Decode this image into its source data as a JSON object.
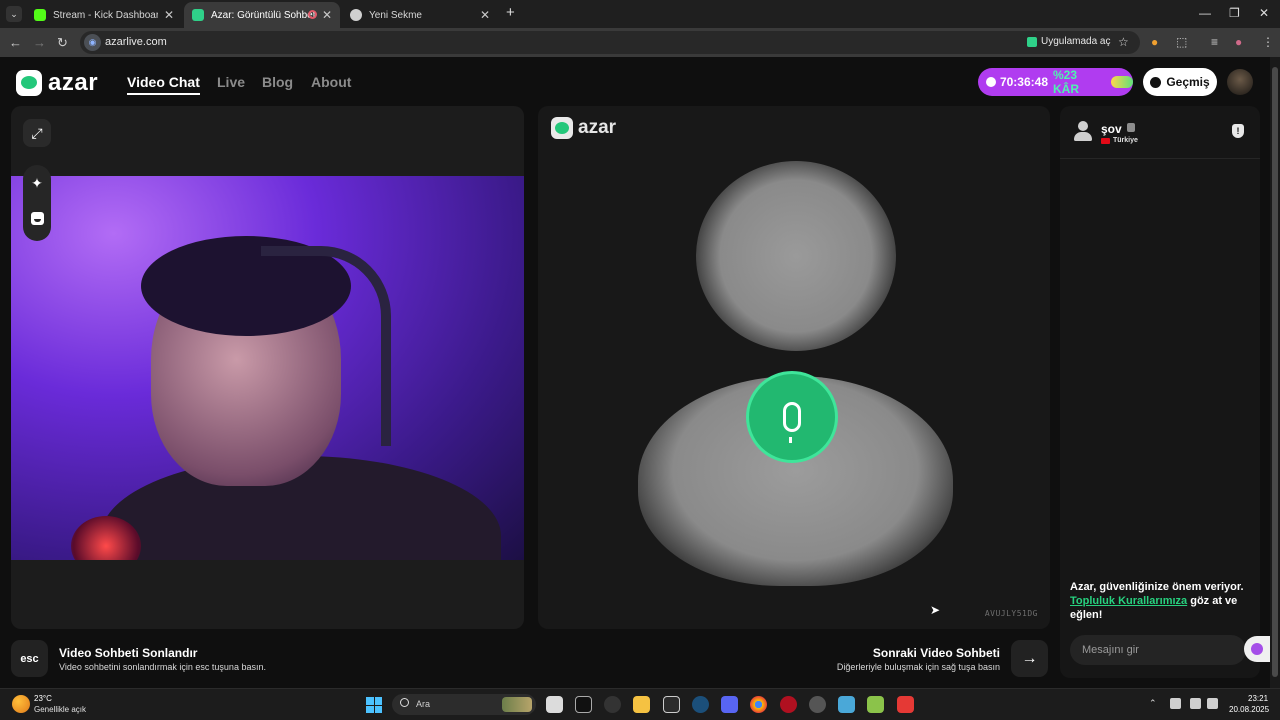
{
  "browser": {
    "tabs": [
      {
        "label": "Stream - Kick Dashboard",
        "icon": "kick-icon",
        "color": "#53fc18"
      },
      {
        "label": "Azar: Görüntülü Sohbet, Arl",
        "icon": "azar-icon",
        "color": "#2fd189"
      },
      {
        "label": "Yeni Sekme",
        "icon": "chrome-icon",
        "color": "#d0d0d0"
      }
    ],
    "new_tab": "+",
    "url": "azarlive.com",
    "open_in_app": "Uygulamada aç"
  },
  "header": {
    "logo_text": "azar",
    "nav": [
      {
        "label": "Video Chat"
      },
      {
        "label": "Live"
      },
      {
        "label": "Blog"
      },
      {
        "label": "About"
      }
    ],
    "timer": "70:36:48",
    "profit": "%23 KÂR",
    "history_label": "Geçmiş"
  },
  "center": {
    "logo_text": "azar",
    "partner_id": "AVUJLY51DG"
  },
  "chat": {
    "peer_name": "şov",
    "peer_country": "Türkiye",
    "safety_prefix": "Azar, güvenliğinize önem veriyor.",
    "safety_link": "Topluluk Kurallarımıza",
    "safety_suffix": "göz at ve eğlen!",
    "input_placeholder": "Mesajını gir"
  },
  "hints": {
    "esc_key": "esc",
    "end_title": "Video Sohbeti Sonlandır",
    "end_desc": "Video sohbetini sonlandırmak için esc tuşuna basın.",
    "next_title": "Sonraki Video Sohbeti",
    "next_desc": "Diğerleriyle buluşmak için sağ tuşa basın"
  },
  "taskbar": {
    "weather_temp": "23°C",
    "weather_desc": "Genellikle açık",
    "search_label": "Ara",
    "time": "23:21",
    "date": "20.08.2025"
  },
  "colors": {
    "accent_green": "#22b870",
    "accent_purple": "#b03cf0"
  }
}
